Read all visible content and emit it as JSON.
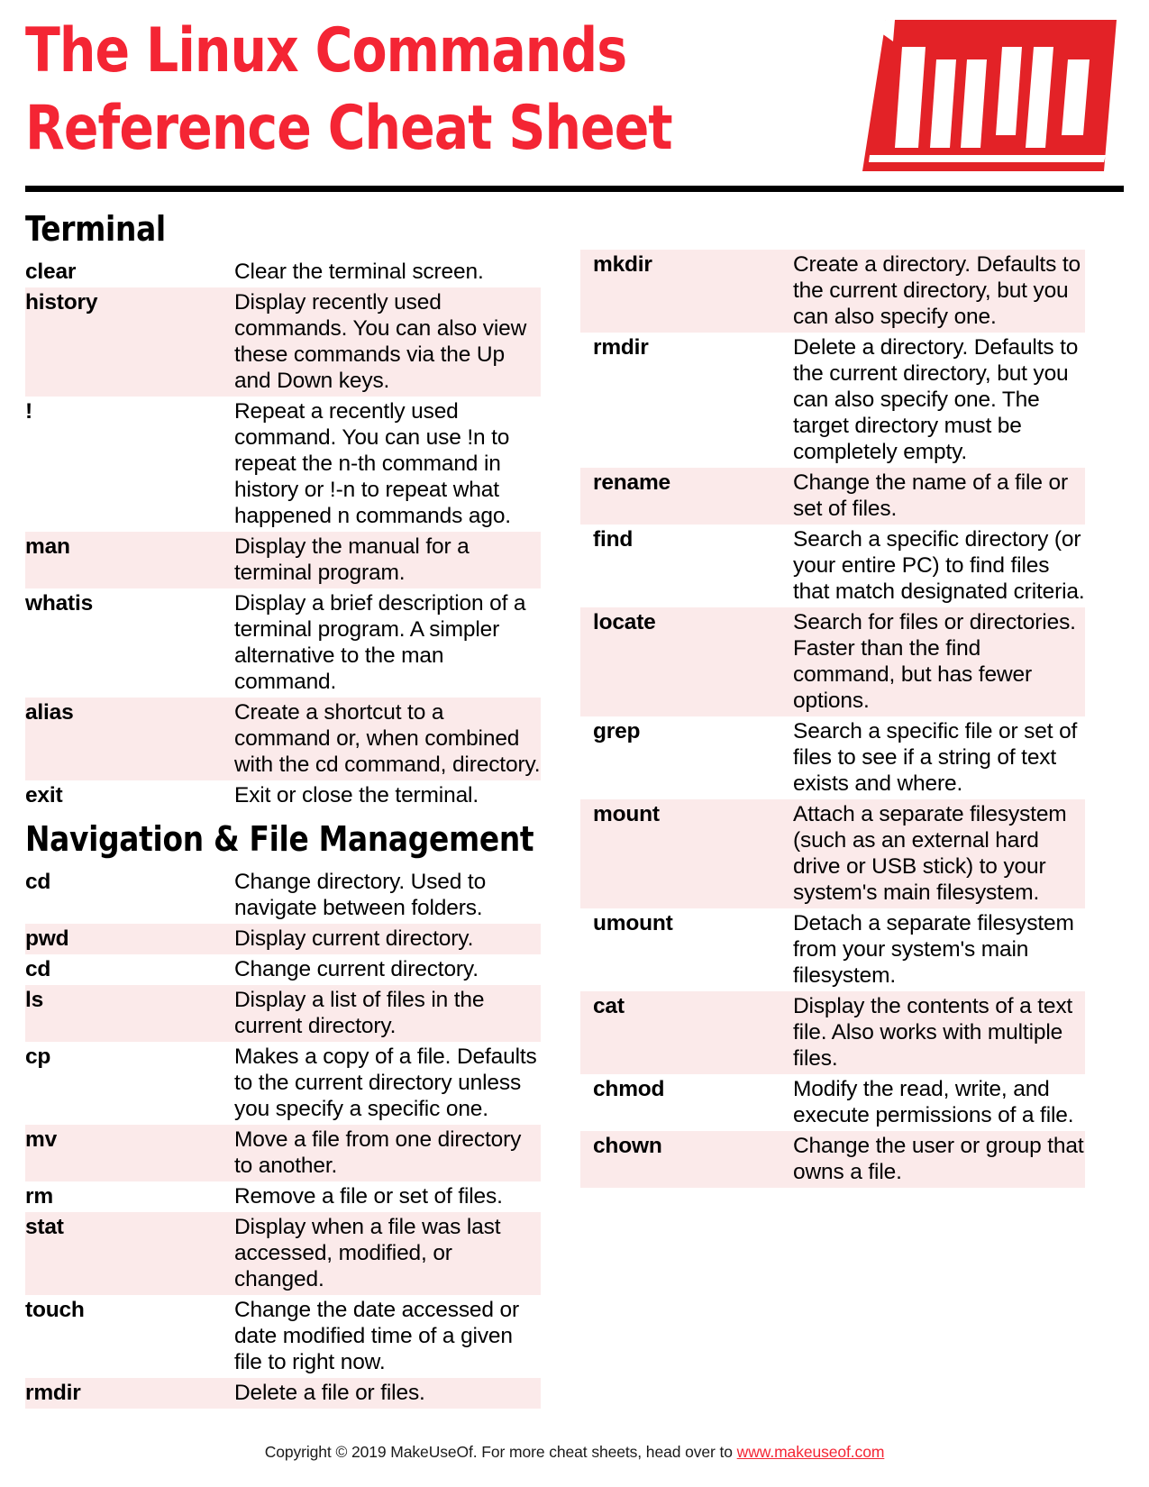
{
  "header": {
    "title_line1": "The Linux Commands",
    "title_line2": "Reference Cheat Sheet",
    "logo_name": "MUO",
    "brand_color": "#f42534"
  },
  "sections": [
    {
      "title": "Terminal",
      "column": "left",
      "rows": [
        {
          "command": "clear",
          "description": "Clear the terminal screen."
        },
        {
          "command": "history",
          "description": "Display recently used commands. You can also view these commands via the Up and Down keys."
        },
        {
          "command": "!",
          "description": "Repeat a recently used command. You can use !n to repeat the n-th command in history or !-n to repeat what happened n commands ago."
        },
        {
          "command": "man",
          "description": "Display the manual for a terminal program."
        },
        {
          "command": "whatis",
          "description": "Display a brief description of a terminal program. A simpler alternative to the man command."
        },
        {
          "command": "alias",
          "description": "Create a shortcut to a command or, when combined with the cd command, directory."
        },
        {
          "command": "exit",
          "description": "Exit or close the terminal."
        }
      ]
    },
    {
      "title": "Navigation & File Management",
      "column": "left",
      "rows": [
        {
          "command": "cd",
          "description": "Change directory. Used to navigate between folders."
        },
        {
          "command": "pwd",
          "description": "Display current directory."
        },
        {
          "command": "cd",
          "description": "Change current directory."
        },
        {
          "command": "ls",
          "description": "Display a list of files in the current directory."
        },
        {
          "command": "cp",
          "description": "Makes a copy of a file. Defaults to the current directory unless you specify a specific one."
        },
        {
          "command": "mv",
          "description": "Move a file from one directory to another."
        },
        {
          "command": "rm",
          "description": "Remove a file or set of files."
        },
        {
          "command": "stat",
          "description": "Display when a file was last accessed, modified, or changed."
        },
        {
          "command": "touch",
          "description": "Change the date accessed or date modified time of a given file to right now."
        },
        {
          "command": "rmdir",
          "description": "Delete a file or files."
        }
      ]
    },
    {
      "title": "",
      "column": "right",
      "rows": [
        {
          "command": "mkdir",
          "description": "Create a directory. Defaults to the current directory, but you can also specify one."
        },
        {
          "command": "rmdir",
          "description": "Delete a directory. Defaults to the current directory, but you can also specify one. The target directory must be completely empty."
        },
        {
          "command": "rename",
          "description": "Change the name of a file or set of files."
        },
        {
          "command": "find",
          "description": "Search a specific directory (or your entire PC) to find files that match designated criteria."
        },
        {
          "command": "locate",
          "description": "Search for files or directories. Faster than the find command, but has fewer options."
        },
        {
          "command": "grep",
          "description": "Search a specific file or set of files to see if a string of text exists and where."
        },
        {
          "command": "mount",
          "description": "Attach a separate filesystem (such as an external hard drive or USB stick) to your system's main filesystem."
        },
        {
          "command": "umount",
          "description": "Detach a separate filesystem from your system's main filesystem."
        },
        {
          "command": "cat",
          "description": "Display the contents of a text file. Also works with multiple files."
        },
        {
          "command": "chmod",
          "description": "Modify the read, write, and execute permissions of a file."
        },
        {
          "command": "chown",
          "description": "Change the user or group that owns a file."
        }
      ]
    }
  ],
  "footer": {
    "text": "Copyright © 2019 MakeUseOf. For more cheat sheets, head over to ",
    "url": "www.makeuseof.com"
  }
}
